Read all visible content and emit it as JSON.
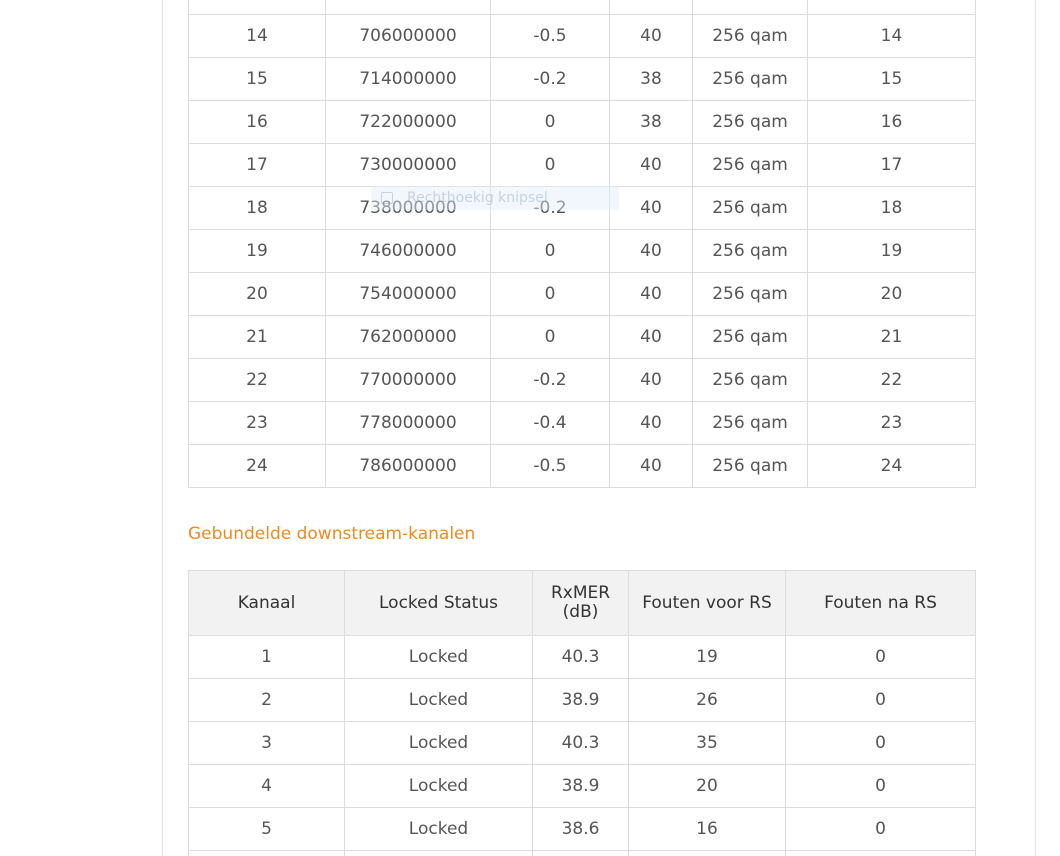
{
  "upper_table": {
    "rows": [
      {
        "channel": "",
        "frequency": "",
        "power": "",
        "snr": "",
        "modulation": "",
        "id": ""
      },
      {
        "channel": "14",
        "frequency": "706000000",
        "power": "-0.5",
        "snr": "40",
        "modulation": "256 qam",
        "id": "14"
      },
      {
        "channel": "15",
        "frequency": "714000000",
        "power": "-0.2",
        "snr": "38",
        "modulation": "256 qam",
        "id": "15"
      },
      {
        "channel": "16",
        "frequency": "722000000",
        "power": "0",
        "snr": "38",
        "modulation": "256 qam",
        "id": "16"
      },
      {
        "channel": "17",
        "frequency": "730000000",
        "power": "0",
        "snr": "40",
        "modulation": "256 qam",
        "id": "17"
      },
      {
        "channel": "18",
        "frequency": "738000000",
        "power": "-0.2",
        "snr": "40",
        "modulation": "256 qam",
        "id": "18"
      },
      {
        "channel": "19",
        "frequency": "746000000",
        "power": "0",
        "snr": "40",
        "modulation": "256 qam",
        "id": "19"
      },
      {
        "channel": "20",
        "frequency": "754000000",
        "power": "0",
        "snr": "40",
        "modulation": "256 qam",
        "id": "20"
      },
      {
        "channel": "21",
        "frequency": "762000000",
        "power": "0",
        "snr": "40",
        "modulation": "256 qam",
        "id": "21"
      },
      {
        "channel": "22",
        "frequency": "770000000",
        "power": "-0.2",
        "snr": "40",
        "modulation": "256 qam",
        "id": "22"
      },
      {
        "channel": "23",
        "frequency": "778000000",
        "power": "-0.4",
        "snr": "40",
        "modulation": "256 qam",
        "id": "23"
      },
      {
        "channel": "24",
        "frequency": "786000000",
        "power": "-0.5",
        "snr": "40",
        "modulation": "256 qam",
        "id": "24"
      }
    ]
  },
  "snip_overlay": {
    "text": "Rechthoekig knipsel"
  },
  "bonded_section": {
    "title": "Gebundelde downstream-kanalen",
    "headers": {
      "channel": "Kanaal",
      "locked_status": "Locked Status",
      "rxmer_line1": "RxMER",
      "rxmer_line2": "(dB)",
      "pre_rs_errors": "Fouten voor RS",
      "post_rs_errors": "Fouten na RS"
    },
    "rows": [
      {
        "channel": "1",
        "status": "Locked",
        "rxmer": "40.3",
        "pre_rs": "19",
        "post_rs": "0"
      },
      {
        "channel": "2",
        "status": "Locked",
        "rxmer": "38.9",
        "pre_rs": "26",
        "post_rs": "0"
      },
      {
        "channel": "3",
        "status": "Locked",
        "rxmer": "40.3",
        "pre_rs": "35",
        "post_rs": "0"
      },
      {
        "channel": "4",
        "status": "Locked",
        "rxmer": "38.9",
        "pre_rs": "20",
        "post_rs": "0"
      },
      {
        "channel": "5",
        "status": "Locked",
        "rxmer": "38.6",
        "pre_rs": "16",
        "post_rs": "0"
      },
      {
        "channel": "",
        "status": "",
        "rxmer": "",
        "pre_rs": "",
        "post_rs": ""
      }
    ]
  },
  "colors": {
    "accent": "#f08a1c",
    "header_background": "#f2f2f2",
    "border": "#dcdcdc",
    "text": "#555555"
  }
}
